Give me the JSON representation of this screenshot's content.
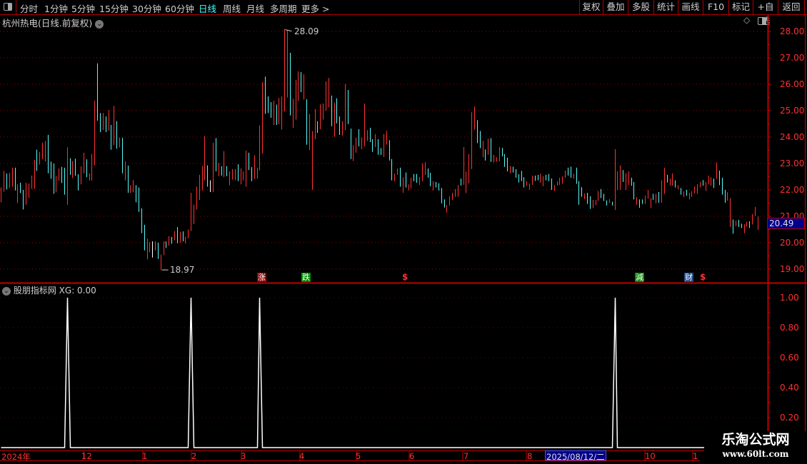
{
  "toolbar": {
    "periods": [
      "分时",
      "1分钟",
      "5分钟",
      "15分钟",
      "30分钟",
      "60分钟",
      "日线",
      "周线",
      "月线",
      "多周期",
      "更多 >"
    ],
    "active_period": "日线",
    "actions": [
      "复权",
      "叠加",
      "多股",
      "统计",
      "画线",
      "F10",
      "标记",
      "+自选",
      "返回"
    ]
  },
  "chart": {
    "title": "杭州热电(日线.前复权)",
    "high_label": "28.09",
    "low_label": "18.97",
    "current_price": "20.49",
    "price_ticks": [
      "28.00",
      "27.00",
      "26.00",
      "25.00",
      "24.00",
      "23.00",
      "22.00",
      "21.00",
      "20.00",
      "19.00"
    ],
    "colors": {
      "up": "#ff3232",
      "down": "#54fcfc",
      "flat": "#ffffff",
      "grid": "#a00000",
      "axis": "#c00000"
    },
    "markers": [
      {
        "type": "text",
        "text": "涨",
        "bg": "#8c0000"
      },
      {
        "type": "text",
        "text": "跌",
        "bg": "#008c00"
      },
      {
        "type": "dollar",
        "text": "$"
      },
      {
        "type": "text",
        "text": "減",
        "bg": "#008c00"
      },
      {
        "type": "text",
        "text": "财",
        "bg": "#1a4a8c"
      },
      {
        "type": "dollar",
        "text": "$"
      }
    ],
    "candles_hld": [
      [
        22.09,
        21.53,
        1
      ],
      [
        22.72,
        21.93,
        1
      ],
      [
        22.62,
        22.02,
        -1
      ],
      [
        22.65,
        22.07,
        1
      ],
      [
        22.84,
        22.12,
        1
      ],
      [
        22.84,
        21.98,
        -1
      ],
      [
        22.21,
        21.5,
        1
      ],
      [
        22.27,
        21.88,
        -1
      ],
      [
        22.0,
        21.26,
        -1
      ],
      [
        22.27,
        21.44,
        1
      ],
      [
        22.24,
        21.7,
        1
      ],
      [
        22.54,
        22.04,
        1
      ],
      [
        23.14,
        22.04,
        1
      ],
      [
        23.52,
        22.72,
        -1
      ],
      [
        23.44,
        22.96,
        1
      ],
      [
        23.79,
        23.16,
        1
      ],
      [
        23.85,
        23.07,
        1
      ],
      [
        24.08,
        22.63,
        -1
      ],
      [
        23.07,
        22.42,
        -1
      ],
      [
        23.0,
        21.85,
        -1
      ],
      [
        22.53,
        21.91,
        1
      ],
      [
        22.81,
        22.35,
        1
      ],
      [
        22.87,
        22.26,
        -1
      ],
      [
        22.84,
        21.82,
        -1
      ],
      [
        23.61,
        21.44,
        1
      ],
      [
        23.2,
        22.57,
        -1
      ],
      [
        23.09,
        22.45,
        1
      ],
      [
        23.18,
        22.53,
        -1
      ],
      [
        22.59,
        21.98,
        -1
      ],
      [
        22.89,
        22.21,
        1
      ],
      [
        23.41,
        22.62,
        1
      ],
      [
        23.16,
        22.48,
        -1
      ],
      [
        22.62,
        22.35,
        1
      ],
      [
        23.36,
        22.35,
        1
      ],
      [
        25.38,
        22.93,
        1
      ],
      [
        26.79,
        24.62,
        -1
      ],
      [
        24.91,
        24.19,
        -1
      ],
      [
        24.91,
        24.26,
        1
      ],
      [
        24.78,
        24.19,
        -1
      ],
      [
        25.03,
        24.24,
        1
      ],
      [
        24.46,
        23.52,
        -1
      ],
      [
        25.18,
        23.7,
        1
      ],
      [
        24.6,
        23.56,
        -1
      ],
      [
        23.98,
        23.61,
        1
      ],
      [
        23.97,
        22.63,
        -1
      ],
      [
        23.08,
        22.36,
        1
      ],
      [
        22.92,
        21.89,
        -1
      ],
      [
        22.18,
        21.89,
        1
      ],
      [
        22.38,
        21.91,
        1
      ],
      [
        22.18,
        21.53,
        -1
      ],
      [
        22.09,
        21.17,
        -1
      ],
      [
        21.3,
        20.36,
        -1
      ],
      [
        20.68,
        19.71,
        -1
      ],
      [
        20.16,
        19.37,
        1
      ],
      [
        20.02,
        19.64,
        1
      ],
      [
        20.05,
        19.44,
        0
      ],
      [
        20.05,
        19.71,
        1
      ],
      [
        20.0,
        19.39,
        -1
      ],
      [
        19.55,
        18.97,
        1
      ],
      [
        20.05,
        19.53,
        1
      ],
      [
        20.05,
        19.8,
        -1
      ],
      [
        20.25,
        19.89,
        1
      ],
      [
        20.22,
        19.96,
        -1
      ],
      [
        20.44,
        20.09,
        1
      ],
      [
        20.59,
        19.98,
        -1
      ],
      [
        20.41,
        20.0,
        1
      ],
      [
        20.43,
        20.05,
        -1
      ],
      [
        20.23,
        19.98,
        1
      ],
      [
        20.5,
        20.17,
        1
      ],
      [
        21.89,
        20.44,
        1
      ],
      [
        21.44,
        20.71,
        1
      ],
      [
        22.12,
        21.26,
        1
      ],
      [
        22.57,
        21.62,
        1
      ],
      [
        22.9,
        21.98,
        1
      ],
      [
        24.03,
        22.36,
        1
      ],
      [
        22.93,
        22.12,
        -1
      ],
      [
        22.36,
        21.92,
        0
      ],
      [
        23.78,
        21.91,
        1
      ],
      [
        23.96,
        22.7,
        -1
      ],
      [
        23.02,
        22.52,
        1
      ],
      [
        22.9,
        22.54,
        -1
      ],
      [
        23.47,
        22.48,
        1
      ],
      [
        22.9,
        22.52,
        -1
      ],
      [
        22.7,
        22.18,
        1
      ],
      [
        22.79,
        22.39,
        1
      ],
      [
        22.79,
        22.36,
        1
      ],
      [
        22.97,
        22.33,
        -1
      ],
      [
        22.81,
        22.21,
        1
      ],
      [
        22.7,
        22.36,
        1
      ],
      [
        23.49,
        22.12,
        1
      ],
      [
        23.41,
        22.75,
        -1
      ],
      [
        22.86,
        22.33,
        -1
      ],
      [
        23.31,
        22.41,
        1
      ],
      [
        22.84,
        22.43,
        1
      ],
      [
        24.44,
        22.74,
        1
      ],
      [
        26.08,
        23.38,
        1
      ],
      [
        26.29,
        24.88,
        -1
      ],
      [
        25.54,
        24.91,
        -1
      ],
      [
        25.32,
        24.73,
        -1
      ],
      [
        25.38,
        24.46,
        1
      ],
      [
        25.23,
        24.46,
        -1
      ],
      [
        25.48,
        24.49,
        1
      ],
      [
        25.54,
        24.28,
        1
      ],
      [
        28.09,
        24.97,
        1
      ],
      [
        28.04,
        25.5,
        1
      ],
      [
        27.19,
        24.82,
        -1
      ],
      [
        25.45,
        24.35,
        1
      ],
      [
        26.17,
        24.66,
        1
      ],
      [
        26.49,
        25.36,
        1
      ],
      [
        26.46,
        25.7,
        -1
      ],
      [
        26.38,
        25.42,
        1
      ],
      [
        25.43,
        23.71,
        -1
      ],
      [
        24.87,
        23.51,
        1
      ],
      [
        24.23,
        22.0,
        1
      ],
      [
        25.06,
        23.92,
        1
      ],
      [
        24.6,
        24.16,
        -1
      ],
      [
        25.24,
        24.3,
        1
      ],
      [
        25.27,
        24.66,
        1
      ],
      [
        26.11,
        25.0,
        1
      ],
      [
        26.24,
        25.12,
        1
      ],
      [
        25.57,
        24.41,
        -1
      ],
      [
        25.3,
        24.01,
        1
      ],
      [
        25.47,
        24.52,
        -1
      ],
      [
        24.78,
        24.08,
        -1
      ],
      [
        24.6,
        24.05,
        1
      ],
      [
        26.01,
        24.26,
        1
      ],
      [
        25.78,
        24.49,
        -1
      ],
      [
        24.32,
        23.17,
        -1
      ],
      [
        23.69,
        23.09,
        1
      ],
      [
        23.98,
        23.41,
        1
      ],
      [
        24.3,
        23.65,
        -1
      ],
      [
        23.98,
        23.54,
        1
      ],
      [
        25.27,
        23.65,
        1
      ],
      [
        24.26,
        23.85,
        1
      ],
      [
        24.35,
        23.81,
        -1
      ],
      [
        23.92,
        23.44,
        -1
      ],
      [
        24.11,
        23.62,
        1
      ],
      [
        23.92,
        23.33,
        -1
      ],
      [
        23.58,
        23.32,
        -1
      ],
      [
        24.11,
        23.24,
        1
      ],
      [
        24.24,
        23.71,
        1
      ],
      [
        23.88,
        23.11,
        -1
      ],
      [
        23.17,
        22.36,
        -1
      ],
      [
        22.61,
        22.33,
        1
      ],
      [
        22.81,
        22.57,
        1
      ],
      [
        22.84,
        22.12,
        -1
      ],
      [
        22.48,
        21.89,
        1
      ],
      [
        22.66,
        22.09,
        -1
      ],
      [
        22.21,
        21.98,
        1
      ],
      [
        22.46,
        22.05,
        1
      ],
      [
        22.6,
        22.33,
        -1
      ],
      [
        22.6,
        22.27,
        -1
      ],
      [
        22.48,
        22.19,
        1
      ],
      [
        23.0,
        22.33,
        1
      ],
      [
        23.05,
        22.57,
        1
      ],
      [
        22.81,
        22.46,
        -1
      ],
      [
        22.65,
        22.14,
        -1
      ],
      [
        22.33,
        21.98,
        1
      ],
      [
        22.3,
        22.09,
        -1
      ],
      [
        22.25,
        21.98,
        -1
      ],
      [
        22.07,
        21.49,
        -1
      ],
      [
        21.64,
        21.33,
        -1
      ],
      [
        21.42,
        21.14,
        1
      ],
      [
        21.76,
        21.4,
        1
      ],
      [
        21.89,
        21.62,
        1
      ],
      [
        22.03,
        21.74,
        1
      ],
      [
        22.19,
        21.74,
        1
      ],
      [
        22.43,
        22.16,
        -1
      ],
      [
        23.62,
        22.19,
        1
      ],
      [
        22.7,
        21.88,
        1
      ],
      [
        23.35,
        22.25,
        1
      ],
      [
        24.94,
        22.79,
        1
      ],
      [
        25.16,
        24.28,
        1
      ],
      [
        24.64,
        23.77,
        -1
      ],
      [
        24.23,
        23.58,
        -1
      ],
      [
        23.86,
        23.24,
        1
      ],
      [
        23.53,
        23.11,
        -1
      ],
      [
        23.94,
        23.33,
        1
      ],
      [
        23.96,
        23.06,
        -1
      ],
      [
        23.32,
        23.04,
        1
      ],
      [
        23.24,
        23.06,
        1
      ],
      [
        23.62,
        23.08,
        1
      ],
      [
        23.59,
        23.27,
        -1
      ],
      [
        23.35,
        22.87,
        -1
      ],
      [
        23.22,
        22.7,
        -1
      ],
      [
        22.91,
        22.63,
        1
      ],
      [
        22.88,
        22.66,
        -1
      ],
      [
        22.78,
        22.46,
        -1
      ],
      [
        22.59,
        22.28,
        -1
      ],
      [
        22.72,
        22.33,
        -1
      ],
      [
        22.48,
        22.09,
        -1
      ],
      [
        22.33,
        22.15,
        1
      ],
      [
        22.24,
        22.01,
        1
      ],
      [
        22.54,
        22.19,
        1
      ],
      [
        22.54,
        22.34,
        -1
      ],
      [
        22.57,
        22.36,
        -1
      ],
      [
        22.61,
        22.27,
        1
      ],
      [
        22.52,
        22.14,
        1
      ],
      [
        22.57,
        22.36,
        -1
      ],
      [
        22.6,
        22.33,
        -1
      ],
      [
        22.43,
        22.0,
        -1
      ],
      [
        22.18,
        21.96,
        1
      ],
      [
        22.32,
        22.16,
        1
      ],
      [
        22.46,
        22.19,
        1
      ],
      [
        22.51,
        22.23,
        1
      ],
      [
        22.73,
        22.46,
        1
      ],
      [
        22.84,
        22.54,
        -1
      ],
      [
        22.88,
        22.46,
        -1
      ],
      [
        22.61,
        22.43,
        1
      ],
      [
        22.84,
        22.23,
        -1
      ],
      [
        22.33,
        21.44,
        -1
      ],
      [
        22.1,
        21.74,
        -1
      ],
      [
        21.86,
        21.65,
        1
      ],
      [
        21.89,
        21.47,
        -1
      ],
      [
        21.76,
        21.28,
        -1
      ],
      [
        21.62,
        21.31,
        1
      ],
      [
        21.62,
        21.42,
        1
      ],
      [
        21.96,
        21.58,
        1
      ],
      [
        22.03,
        21.69,
        -1
      ],
      [
        21.85,
        21.58,
        -1
      ],
      [
        21.6,
        21.41,
        -1
      ],
      [
        21.65,
        21.51,
        1
      ],
      [
        21.55,
        21.41,
        -1
      ],
      [
        23.54,
        21.24,
        1
      ],
      [
        22.7,
        22.0,
        1
      ],
      [
        22.93,
        22.0,
        1
      ],
      [
        22.75,
        22.3,
        -1
      ],
      [
        22.63,
        22.0,
        1
      ],
      [
        22.7,
        22.19,
        1
      ],
      [
        22.46,
        22.16,
        -1
      ],
      [
        22.3,
        21.64,
        -1
      ],
      [
        21.73,
        21.44,
        1
      ],
      [
        21.64,
        21.32,
        -1
      ],
      [
        21.64,
        21.47,
        -1
      ],
      [
        21.78,
        21.47,
        1
      ],
      [
        22.0,
        21.67,
        1
      ],
      [
        21.69,
        21.31,
        1
      ],
      [
        21.85,
        21.62,
        -1
      ],
      [
        21.85,
        21.49,
        1
      ],
      [
        21.92,
        21.51,
        -1
      ],
      [
        22.36,
        21.51,
        1
      ],
      [
        22.84,
        21.85,
        1
      ],
      [
        22.57,
        22.28,
        -1
      ],
      [
        22.43,
        22.16,
        1
      ],
      [
        22.63,
        22.16,
        1
      ],
      [
        22.36,
        22.09,
        -1
      ],
      [
        22.18,
        22.03,
        1
      ],
      [
        22.07,
        21.82,
        -1
      ],
      [
        21.94,
        21.73,
        1
      ],
      [
        22.0,
        21.78,
        -1
      ],
      [
        21.89,
        21.64,
        1
      ],
      [
        21.95,
        21.73,
        1
      ],
      [
        22.13,
        21.87,
        1
      ],
      [
        22.22,
        21.85,
        1
      ],
      [
        22.3,
        22.09,
        1
      ],
      [
        22.37,
        22.16,
        -1
      ],
      [
        22.3,
        21.96,
        1
      ],
      [
        22.54,
        22.21,
        1
      ],
      [
        22.48,
        22.16,
        1
      ],
      [
        22.43,
        22.07,
        -1
      ],
      [
        23.04,
        22.42,
        1
      ],
      [
        22.73,
        22.18,
        -1
      ],
      [
        22.46,
        21.82,
        -1
      ],
      [
        22.0,
        21.51,
        -1
      ],
      [
        21.91,
        21.59,
        1
      ],
      [
        21.69,
        20.6,
        1
      ],
      [
        20.88,
        20.34,
        -1
      ],
      [
        20.84,
        20.63,
        1
      ],
      [
        20.86,
        20.59,
        -1
      ],
      [
        20.72,
        20.56,
        -1
      ],
      [
        20.7,
        20.36,
        1
      ],
      [
        20.79,
        20.61,
        1
      ],
      [
        20.81,
        20.56,
        -1
      ],
      [
        21.08,
        20.69,
        1
      ],
      [
        21.35,
        21.01,
        1
      ],
      [
        20.99,
        20.49,
        1
      ]
    ]
  },
  "indicator": {
    "title": "股朋指标网",
    "value_label": "XG: 0.00",
    "ticks": [
      "1.00",
      "0.80",
      "0.60",
      "0.40",
      "0.20"
    ],
    "signal_candles": [
      25,
      70,
      95,
      224
    ],
    "line_color": "#ffffff"
  },
  "time_axis": {
    "labels": [
      "2024年",
      "12",
      "1",
      "2",
      "3",
      "4",
      "5",
      "6",
      "7",
      "8",
      "10",
      "1"
    ],
    "highlight": "2025/08/12/二"
  },
  "watermark": {
    "name": "乐淘公式网",
    "url": "www.60lt.com"
  }
}
